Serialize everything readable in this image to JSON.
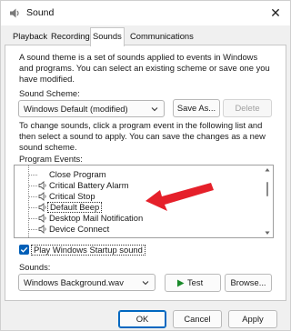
{
  "window": {
    "title": "Sound",
    "close_glyph": "✕"
  },
  "tabs": [
    {
      "label": "Playback"
    },
    {
      "label": "Recording"
    },
    {
      "label": "Sounds"
    },
    {
      "label": "Communications"
    }
  ],
  "intro_text": [
    "A sound theme is a set of sounds applied to events in Windows",
    "and programs.  You can select an existing scheme or save one you",
    "have modified."
  ],
  "scheme": {
    "label": "Sound Scheme:",
    "value": "Windows Default (modified)",
    "save_as_label": "Save As...",
    "delete_label": "Delete"
  },
  "change_text": [
    "To change sounds, click a program event in the following list and",
    "then select a sound to apply.  You can save the changes as a new",
    "sound scheme."
  ],
  "events": {
    "label": "Program Events:",
    "items": [
      {
        "label": "Close Program",
        "has_sound": false
      },
      {
        "label": "Critical Battery Alarm",
        "has_sound": true
      },
      {
        "label": "Critical Stop",
        "has_sound": true
      },
      {
        "label": "Default Beep",
        "has_sound": true,
        "selected": true
      },
      {
        "label": "Desktop Mail Notification",
        "has_sound": true
      },
      {
        "label": "Device Connect",
        "has_sound": true
      }
    ]
  },
  "startup": {
    "label": "Play Windows Startup sound",
    "checked": true
  },
  "sounds": {
    "label": "Sounds:",
    "value": "Windows Background.wav",
    "test_label": "Test",
    "browse_label": "Browse..."
  },
  "footer": {
    "ok_label": "OK",
    "cancel_label": "Cancel",
    "apply_label": "Apply"
  },
  "colors": {
    "accent": "#005fb8",
    "arrow": "#e5202a"
  }
}
